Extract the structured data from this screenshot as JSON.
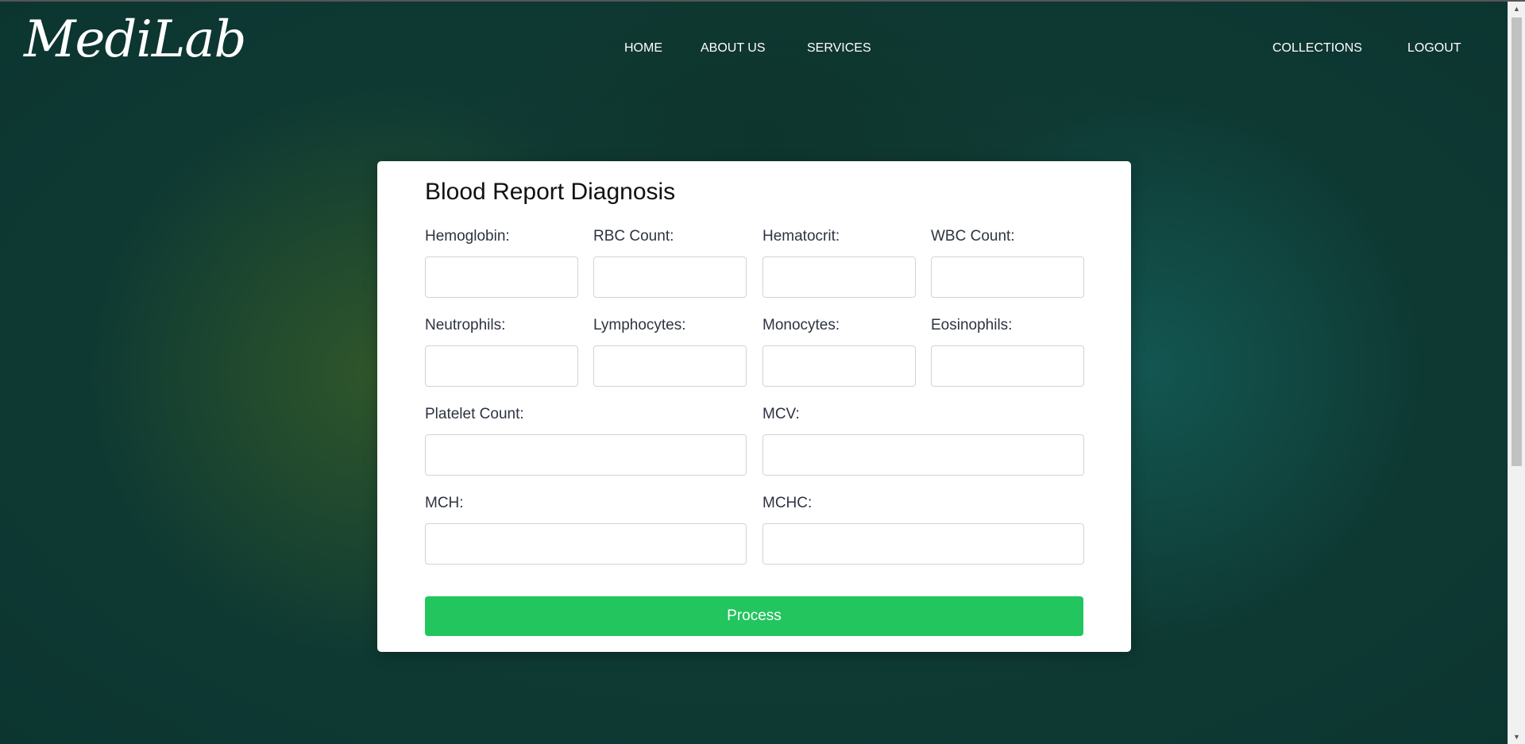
{
  "brand": {
    "logo_text": "MediLab"
  },
  "nav": {
    "center": [
      "HOME",
      "ABOUT US",
      "SERVICES"
    ],
    "right": [
      "COLLECTIONS",
      "LOGOUT"
    ]
  },
  "form": {
    "title": "Blood Report Diagnosis",
    "fields": {
      "hemoglobin": {
        "label": "Hemoglobin:",
        "value": ""
      },
      "rbc_count": {
        "label": "RBC Count:",
        "value": ""
      },
      "hematocrit": {
        "label": "Hematocrit:",
        "value": ""
      },
      "wbc_count": {
        "label": "WBC Count:",
        "value": ""
      },
      "neutrophils": {
        "label": "Neutrophils:",
        "value": ""
      },
      "lymphocytes": {
        "label": "Lymphocytes:",
        "value": ""
      },
      "monocytes": {
        "label": "Monocytes:",
        "value": ""
      },
      "eosinophils": {
        "label": "Eosinophils:",
        "value": ""
      },
      "platelet_count": {
        "label": "Platelet Count:",
        "value": ""
      },
      "mcv": {
        "label": "MCV:",
        "value": ""
      },
      "mch": {
        "label": "MCH:",
        "value": ""
      },
      "mchc": {
        "label": "MCHC:",
        "value": ""
      }
    },
    "submit_label": "Process"
  },
  "colors": {
    "accent": "#22c55e",
    "background": "#0f3a34",
    "card": "#ffffff"
  }
}
